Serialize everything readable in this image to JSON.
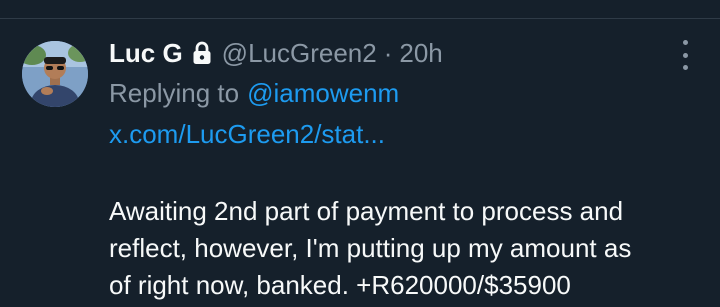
{
  "tweet": {
    "display_name": "Luc G",
    "handle": "@LucGreen2",
    "separator": "·",
    "time": "20h",
    "reply_prefix": "Replying to",
    "reply_handle": "@iamowenm",
    "link": "x.com/LucGreen2/stat...",
    "body_lines": [
      "Awaiting 2nd part of payment to process and",
      "reflect, however, I'm putting up my amount as",
      "of right now, banked. +R620000/$35900"
    ]
  },
  "icons": {
    "lock": "lock-icon",
    "more": "more-options-icon"
  },
  "colors": {
    "background": "#15202b",
    "primary_text": "#f7f9f9",
    "secondary_text": "#8b98a5",
    "link": "#1d9bf0"
  }
}
